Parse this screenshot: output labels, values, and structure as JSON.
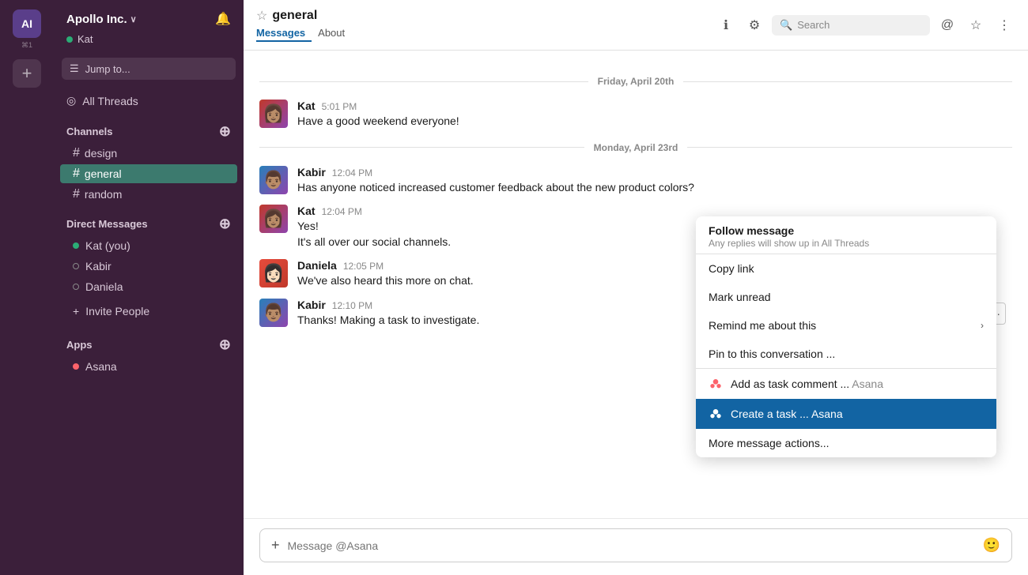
{
  "workspace": {
    "name": "Apollo Inc.",
    "initials": "AI",
    "shortcut": "⌘1",
    "current_user": "Kat"
  },
  "sidebar": {
    "jump_to_label": "Jump to...",
    "all_threads_label": "All Threads",
    "channels_label": "Channels",
    "channels": [
      {
        "name": "design",
        "active": false
      },
      {
        "name": "general",
        "active": true
      },
      {
        "name": "random",
        "active": false
      }
    ],
    "direct_messages_label": "Direct Messages",
    "direct_messages": [
      {
        "name": "Kat",
        "suffix": "(you)",
        "online": true
      },
      {
        "name": "Kabir",
        "online": false
      },
      {
        "name": "Daniela",
        "online": false
      }
    ],
    "invite_people_label": "Invite People",
    "apps_label": "Apps",
    "apps": [
      {
        "name": "Asana",
        "online": true,
        "color": "#fc636b"
      }
    ]
  },
  "channel": {
    "name": "general",
    "tab_messages": "Messages",
    "tab_about": "About",
    "active_tab": "Messages",
    "search_placeholder": "Search"
  },
  "messages": {
    "date_1": "Friday, April 20th",
    "date_2": "Monday, April 23rd",
    "items": [
      {
        "author": "Kat",
        "time": "5:01 PM",
        "text": "Have a good weekend everyone!",
        "avatar_type": "kat"
      },
      {
        "author": "Kabir",
        "time": "12:04 PM",
        "text": "Has anyone noticed increased customer feedback about the new product colors?",
        "avatar_type": "kabir"
      },
      {
        "author": "Kat",
        "time": "12:04 PM",
        "text_lines": [
          "Yes!",
          "It's all over our social channels."
        ],
        "avatar_type": "kat"
      },
      {
        "author": "Daniela",
        "time": "12:05 PM",
        "text": "We've also heard this more on chat.",
        "avatar_type": "daniela"
      },
      {
        "author": "Kabir",
        "time": "12:10 PM",
        "text": "Thanks! Making a task to investigate.",
        "avatar_type": "kabir"
      }
    ]
  },
  "context_menu": {
    "follow_title": "Follow message",
    "follow_subtitle": "Any replies will show up in All Threads",
    "copy_link": "Copy link",
    "mark_unread": "Mark unread",
    "remind_me": "Remind me about this",
    "pin_conversation": "Pin to this conversation ...",
    "add_task_comment": "Add as task comment ...",
    "add_task_comment_app": "Asana",
    "create_task": "Create a task ...",
    "create_task_app": "Asana",
    "more_actions": "More message actions..."
  },
  "message_input": {
    "placeholder": "Message @Asana"
  },
  "badge_num": "1"
}
